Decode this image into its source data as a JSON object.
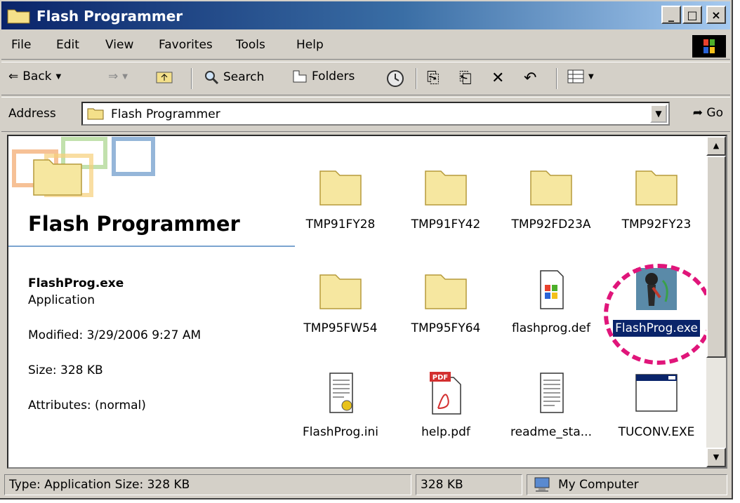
{
  "window": {
    "title": "Flash Programmer"
  },
  "menu": [
    "File",
    "Edit",
    "View",
    "Favorites",
    "Tools",
    "Help"
  ],
  "toolbar": {
    "back": "Back",
    "search": "Search",
    "folders": "Folders"
  },
  "address": {
    "label": "Address",
    "value": "Flash Programmer",
    "go": "Go"
  },
  "panel": {
    "title": "Flash Programmer",
    "file_name": "FlashProg.exe",
    "file_type": "Application",
    "modified": "Modified: 3/29/2006 9:27 AM",
    "size": "Size: 328 KB",
    "attributes": "Attributes: (normal)"
  },
  "items": [
    {
      "label": "TMP91FY28",
      "icon": "folder-icon"
    },
    {
      "label": "TMP91FY42",
      "icon": "folder-icon"
    },
    {
      "label": "TMP92FD23A",
      "icon": "folder-icon"
    },
    {
      "label": "TMP92FY23",
      "icon": "folder-icon"
    },
    {
      "label": "TMP95FW54",
      "icon": "folder-icon"
    },
    {
      "label": "TMP95FY64",
      "icon": "folder-icon"
    },
    {
      "label": "flashprog.def",
      "icon": "windows-file-icon"
    },
    {
      "label": "FlashProg.exe",
      "icon": "application-icon",
      "selected": true
    },
    {
      "label": "FlashProg.ini",
      "icon": "config-file-icon"
    },
    {
      "label": "help.pdf",
      "icon": "pdf-icon"
    },
    {
      "label": "readme_sta...",
      "icon": "text-file-icon"
    },
    {
      "label": "TUCONV.EXE",
      "icon": "window-app-icon"
    }
  ],
  "pdf_badge": "PDF",
  "status": {
    "type": "Type: Application Size: 328 KB",
    "size": "328 KB",
    "zone": "My Computer"
  },
  "colors": {
    "highlight": "#e0157a",
    "selection": "#0a246a",
    "title_start": "#0a246a"
  }
}
